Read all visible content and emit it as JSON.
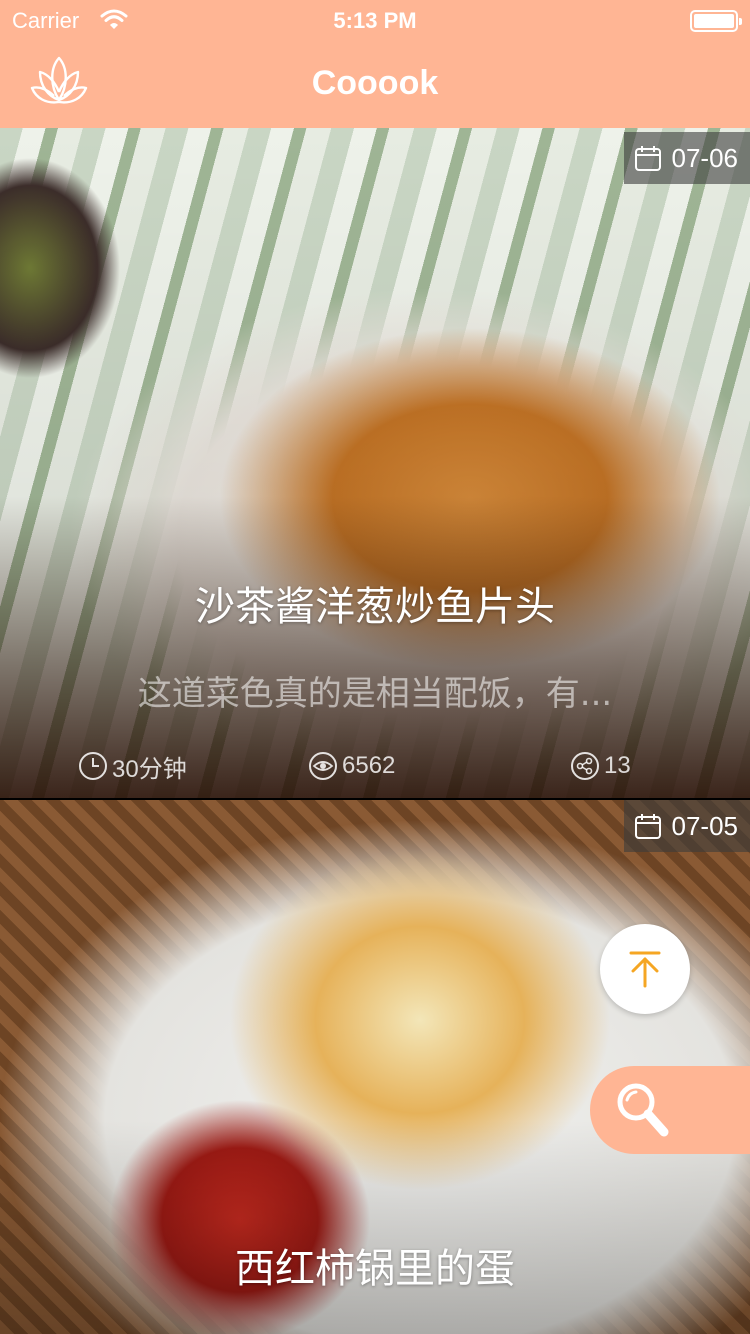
{
  "status_bar": {
    "carrier": "Carrier",
    "time": "5:13 PM"
  },
  "nav": {
    "title": "Cooook",
    "logo_icon": "lotus-icon"
  },
  "colors": {
    "accent": "#FFB594",
    "fab_arrow": "#F5A623"
  },
  "recipes": [
    {
      "date": "07-06",
      "title": "沙茶酱洋葱炒鱼片头",
      "description": "这道菜色真的是相当配饭，有...",
      "duration": "30分钟",
      "views": "6562",
      "shares": "13"
    },
    {
      "date": "07-05",
      "title": "西红柿锅里的蛋"
    }
  ],
  "floating": {
    "scroll_top_icon": "arrow-up-icon",
    "search_icon": "magnifier-icon"
  }
}
